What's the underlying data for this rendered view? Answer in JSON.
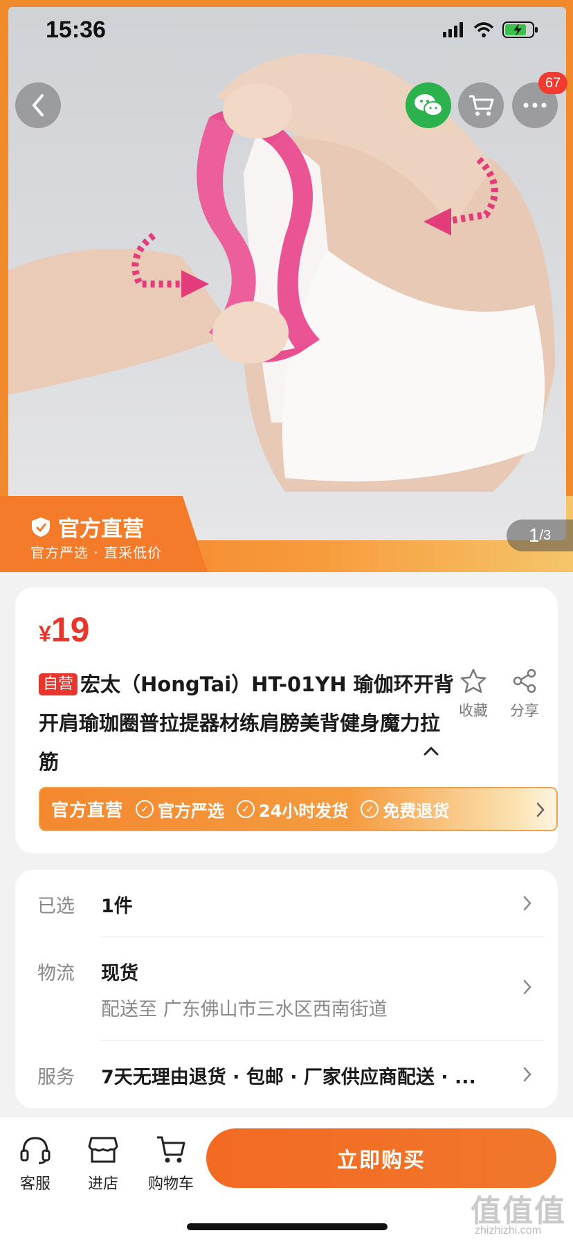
{
  "status_bar": {
    "time": "15:36"
  },
  "header": {
    "cart_badge": "67"
  },
  "hero": {
    "official_title": "官方直营",
    "official_sub": "官方严选 · 直采低价",
    "page_current": "1",
    "page_total": "/3"
  },
  "product": {
    "price_symbol": "¥",
    "price": "19",
    "self_tag": "自营",
    "title": "宏太（HongTai）HT-01YH 瑜伽环开背开肩瑜珈圈普拉提器材练肩膀美背健身魔力拉筋",
    "favorite_label": "收藏",
    "share_label": "分享"
  },
  "service_bar": {
    "main": "官方直营",
    "items": [
      "官方严选",
      "24小时发货",
      "免费退货"
    ]
  },
  "info": {
    "selected_label": "已选",
    "selected_value": "1件",
    "logistics_label": "物流",
    "logistics_value": "现货",
    "logistics_sub": "配送至 广东佛山市三水区西南街道",
    "service_label": "服务",
    "service_value": "7天无理由退货 · 包邮 · 厂家供应商配送 · ..."
  },
  "bottom_bar": {
    "tabs": [
      {
        "label": "客服",
        "icon": "headset-icon"
      },
      {
        "label": "进店",
        "icon": "store-icon"
      },
      {
        "label": "购物车",
        "icon": "cart-icon"
      }
    ],
    "buy_label": "立即购买"
  },
  "watermark": {
    "main": "值值值",
    "sub": "zhizhizhi.com"
  },
  "colors": {
    "accent_orange": "#f47b2a",
    "price_red": "#e8362c",
    "wechat_green": "#2bb24c"
  }
}
